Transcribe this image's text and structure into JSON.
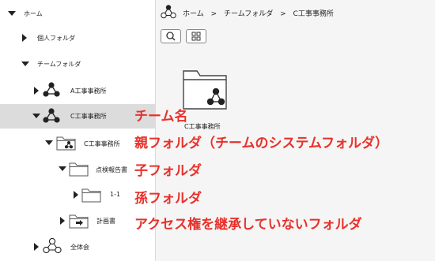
{
  "sidebar": {
    "items": [
      {
        "label": "ホーム",
        "caret": "down",
        "icon": "none"
      },
      {
        "label": "個人フォルダ",
        "caret": "right",
        "icon": "none"
      },
      {
        "label": "チームフォルダ",
        "caret": "down",
        "icon": "none"
      },
      {
        "label": "A工事事務所",
        "caret": "right",
        "icon": "team-icon"
      },
      {
        "label": "C工事事務所",
        "caret": "down",
        "icon": "team-icon",
        "selected": true
      },
      {
        "label": "C工事事務所",
        "caret": "down",
        "icon": "system-folder-icon"
      },
      {
        "label": "点検報告書",
        "caret": "down",
        "icon": "folder-icon"
      },
      {
        "label": "1-1",
        "caret": "right",
        "icon": "folder-icon"
      },
      {
        "label": "計画書",
        "caret": "right",
        "icon": "no-inherit-folder-icon"
      },
      {
        "label": "全体会",
        "caret": "right",
        "icon": "team-outline-icon"
      }
    ]
  },
  "breadcrumb": {
    "items": [
      "ホーム",
      ">",
      "チームフォルダ",
      ">",
      "C工事事務所"
    ]
  },
  "toolbar": {
    "search_icon": "search-icon",
    "grid_icon": "grid-view-icon"
  },
  "main": {
    "folder_label": "C工事事務所"
  },
  "annotations": {
    "team_name": "チーム名",
    "parent_folder": "親フォルダ（チームのシステムフォルダ）",
    "child_folder": "子フォルダ",
    "grandchild_folder": "孫フォルダ",
    "no_inherit": "アクセス権を継承していないフォルダ"
  },
  "colors": {
    "annotation": "#e8312b",
    "selected_row": "#dcdcdc"
  }
}
